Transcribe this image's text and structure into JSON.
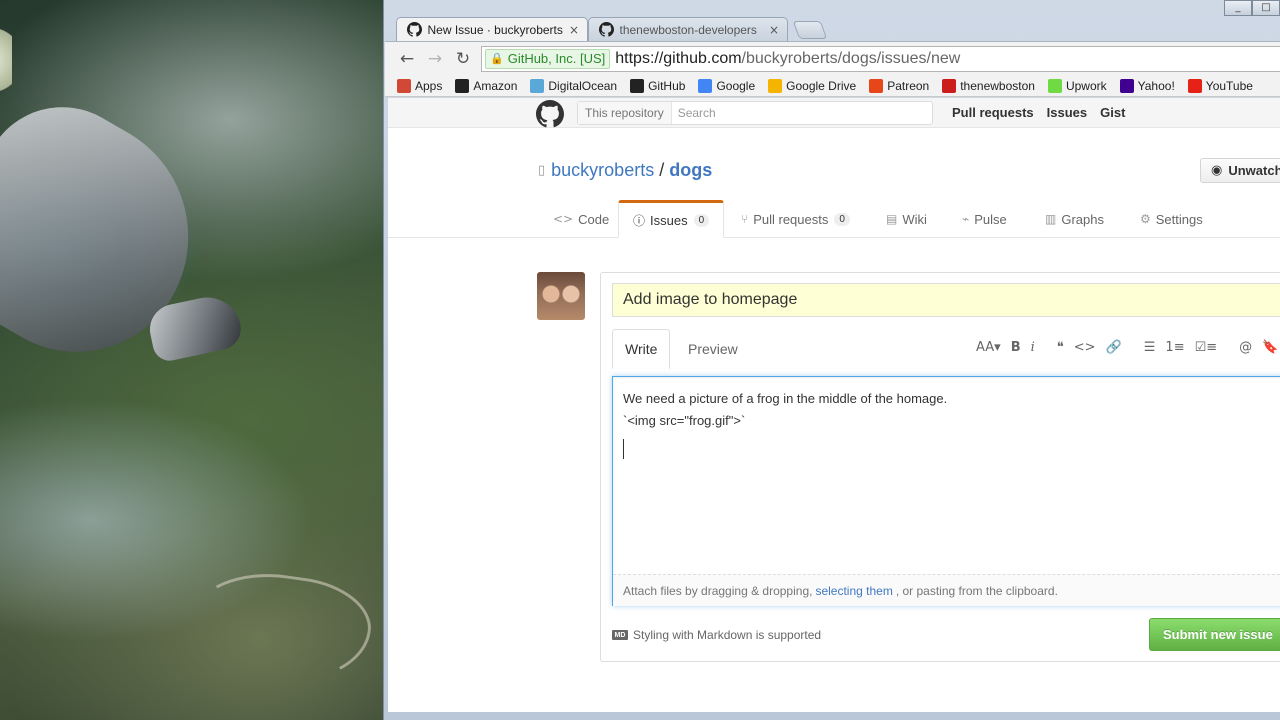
{
  "browser": {
    "window_controls": [
      "_",
      "□"
    ],
    "tabs": [
      {
        "title": "New Issue · buckyroberts/dogs",
        "active": true,
        "close": "×"
      },
      {
        "title": "thenewboston-developers",
        "active": false,
        "close": "×"
      }
    ],
    "address": {
      "ev_label": "GitHub, Inc. [US]",
      "url_host": "https://github.com",
      "url_path": "/buckyroberts/dogs/issues/new"
    },
    "bookmarks": [
      {
        "label": "Apps",
        "icon": "apps-grid-icon",
        "color": "#d14836"
      },
      {
        "label": "Amazon",
        "icon": "amazon-icon",
        "color": "#222222"
      },
      {
        "label": "DigitalOcean",
        "icon": "digitalocean-icon",
        "color": "#5aa8d8"
      },
      {
        "label": "GitHub",
        "icon": "github-icon",
        "color": "#222222"
      },
      {
        "label": "Google",
        "icon": "google-icon",
        "color": "#4285f4"
      },
      {
        "label": "Google Drive",
        "icon": "google-drive-icon",
        "color": "#f4b400"
      },
      {
        "label": "Patreon",
        "icon": "patreon-icon",
        "color": "#e6461a"
      },
      {
        "label": "thenewboston",
        "icon": "thenewboston-icon",
        "color": "#cc1d1d"
      },
      {
        "label": "Upwork",
        "icon": "upwork-icon",
        "color": "#6fda44"
      },
      {
        "label": "Yahoo!",
        "icon": "yahoo-icon",
        "color": "#400191"
      },
      {
        "label": "YouTube",
        "icon": "youtube-icon",
        "color": "#e62117"
      }
    ]
  },
  "github": {
    "search": {
      "scope": "This repository",
      "placeholder": "Search"
    },
    "nav": [
      "Pull requests",
      "Issues",
      "Gist"
    ],
    "repo": {
      "owner": "buckyroberts",
      "separator": "/",
      "name": "dogs"
    },
    "watch_label": "Unwatch",
    "tabs": [
      {
        "label": "Code",
        "icon": "code-icon"
      },
      {
        "label": "Issues",
        "icon": "issue-opened-icon",
        "count": "0",
        "selected": true
      },
      {
        "label": "Pull requests",
        "icon": "pull-request-icon",
        "count": "0"
      },
      {
        "label": "Wiki",
        "icon": "book-icon"
      },
      {
        "label": "Pulse",
        "icon": "pulse-icon"
      },
      {
        "label": "Graphs",
        "icon": "graph-icon"
      },
      {
        "label": "Settings",
        "icon": "gear-icon"
      }
    ],
    "issue": {
      "title_value": "Add image to homepage",
      "write_tab": "Write",
      "preview_tab": "Preview",
      "toolbar": [
        "AA▾",
        "B",
        "i",
        "❝",
        "<>",
        "🔗",
        "☰",
        "1≡",
        "☑≡",
        "@",
        "🔖"
      ],
      "body_lines": [
        "We need a picture of a frog in the middle of the homage.",
        "`<img src=\"frog.gif\">`"
      ],
      "attach_text_before": "Attach files by dragging & dropping,",
      "attach_link": "selecting them",
      "attach_text_after": ", or pasting from the clipboard.",
      "markdown_note": "Styling with Markdown is supported",
      "markdown_icon_text": "MD",
      "submit_label": "Submit new issue"
    }
  },
  "colors": {
    "link": "#4078c0",
    "issue_title_bg": "#ffffd5",
    "selected_tab_accent": "#d26911",
    "submit_green": "#60b044"
  }
}
